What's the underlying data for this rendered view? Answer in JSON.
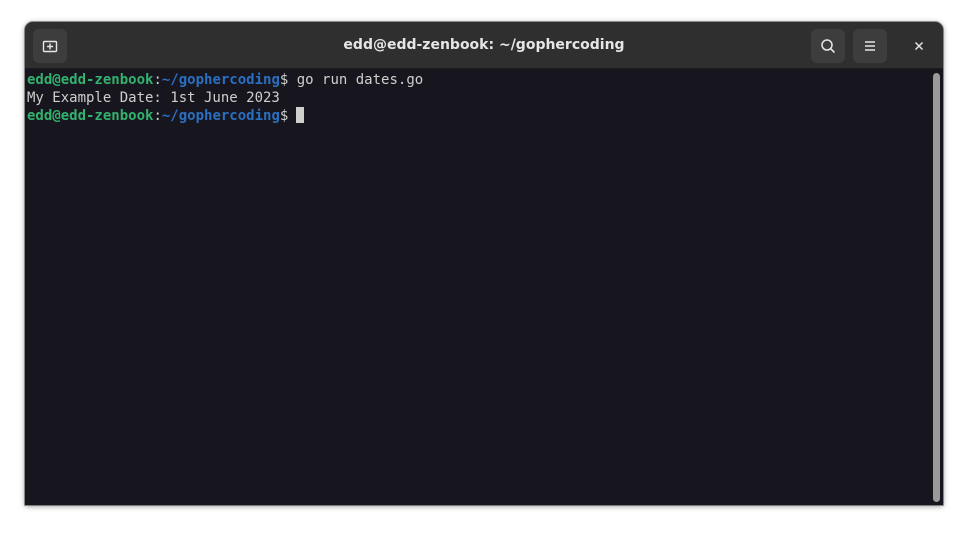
{
  "window": {
    "title": "edd@edd-zenbook: ~/gophercoding"
  },
  "header_buttons": {
    "new_tab_icon": "new-tab-icon",
    "search_icon": "search-icon",
    "menu_icon": "hamburger-menu-icon",
    "close_icon": "close-icon"
  },
  "terminal": {
    "lines": [
      {
        "prompt_user": "edd@edd-zenbook",
        "prompt_sep": ":",
        "prompt_path": "~/gophercoding",
        "prompt_symbol": "$",
        "command": " go run dates.go"
      },
      {
        "output": "My Example Date: 1st June 2023"
      },
      {
        "prompt_user": "edd@edd-zenbook",
        "prompt_sep": ":",
        "prompt_path": "~/gophercoding",
        "prompt_symbol": "$",
        "command": ""
      }
    ]
  },
  "colors": {
    "prompt_user": "#33b26e",
    "prompt_path": "#2a6fc0",
    "background": "#17161f",
    "text": "#d0cfcc"
  }
}
